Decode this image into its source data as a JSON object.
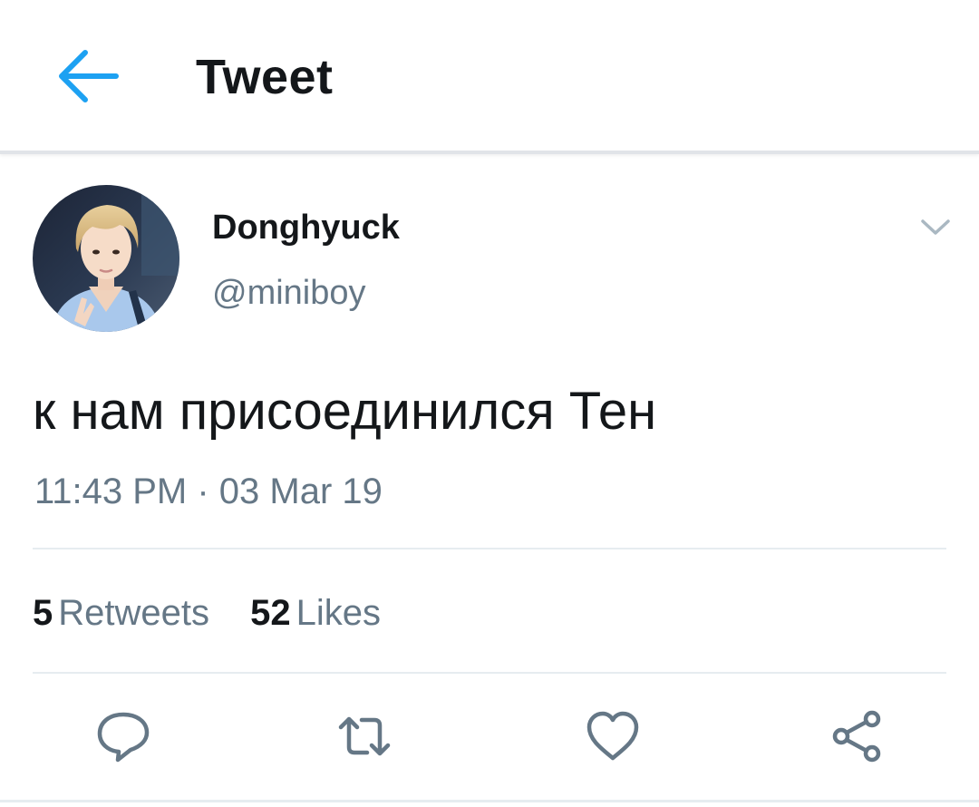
{
  "header": {
    "title": "Tweet",
    "back_icon": "arrow-left-icon",
    "accent_color": "#1da1f2"
  },
  "tweet": {
    "display_name": "Donghyuck",
    "handle": "@miniboy",
    "text": "к нам присоединился Тен",
    "timestamp": "11:43 PM · 03 Mar 19",
    "menu_icon": "chevron-down-icon"
  },
  "stats": {
    "retweets_count": "5",
    "retweets_label": "Retweets",
    "likes_count": "52",
    "likes_label": "Likes"
  },
  "actions": [
    {
      "icon": "reply-icon"
    },
    {
      "icon": "retweet-icon"
    },
    {
      "icon": "heart-icon"
    },
    {
      "icon": "share-icon"
    }
  ],
  "colors": {
    "text_primary": "#14171a",
    "text_secondary": "#657786",
    "divider": "#e6ecf0"
  }
}
